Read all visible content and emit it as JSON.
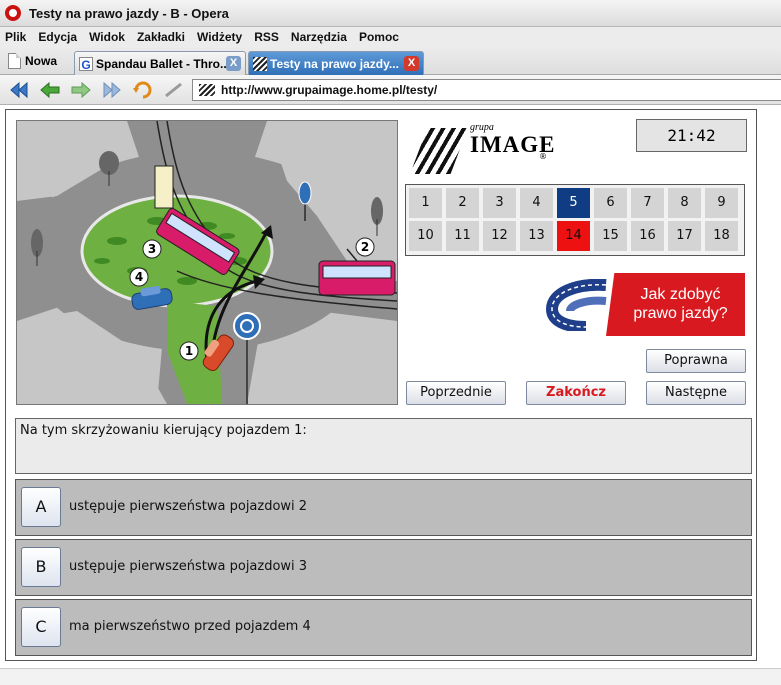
{
  "window": {
    "title": "Testy na prawo jazdy - B - Opera"
  },
  "menu": [
    "Plik",
    "Edycja",
    "Widok",
    "Zakładki",
    "Widżety",
    "RSS",
    "Narzędzia",
    "Pomoc"
  ],
  "tabs": {
    "new_tab_label": "Nowa",
    "items": [
      {
        "label": "Spandau Ballet - Thro...",
        "close": "X",
        "favicon": "G",
        "active": false
      },
      {
        "label": "Testy na prawo jazdy...",
        "close": "X",
        "favicon": "",
        "active": true
      }
    ]
  },
  "toolbar": {
    "buttons": [
      "rewind-icon",
      "back-icon",
      "forward-icon",
      "fast-forward-icon",
      "reload-icon",
      "edit-icon"
    ],
    "url": "http://www.grupaimage.home.pl/testy/"
  },
  "scene": {
    "vehicle_labels": [
      "1",
      "2",
      "3",
      "4"
    ]
  },
  "logo": {
    "small": "grupa",
    "main": "IMAGE",
    "reg": "®"
  },
  "timer": "21:42",
  "questions": {
    "numbers": [
      "1",
      "2",
      "3",
      "4",
      "5",
      "6",
      "7",
      "8",
      "9",
      "10",
      "11",
      "12",
      "13",
      "14",
      "15",
      "16",
      "17",
      "18"
    ],
    "current": "5",
    "wrong": "14"
  },
  "promo": {
    "line1": "Jak zdobyć",
    "line2": "prawo jazdy?"
  },
  "buttons": {
    "correct": "Poprawna",
    "previous": "Poprzednie",
    "finish": "Zakończ",
    "next": "Następne"
  },
  "question_text": "Na tym skrzyżowaniu kierujący pojazdem 1:",
  "answers": [
    {
      "letter": "A",
      "text": "ustępuje pierwszeństwa pojazdowi 2"
    },
    {
      "letter": "B",
      "text": "ustępuje pierwszeństwa pojazdowi 3"
    },
    {
      "letter": "C",
      "text": "ma pierwszeństwo przed pojazdem 4"
    }
  ],
  "colors": {
    "current_question": "#0f3c82",
    "wrong_question": "#ee1111",
    "accent_red": "#d8191f",
    "tab_active": "#2f6fb8"
  }
}
